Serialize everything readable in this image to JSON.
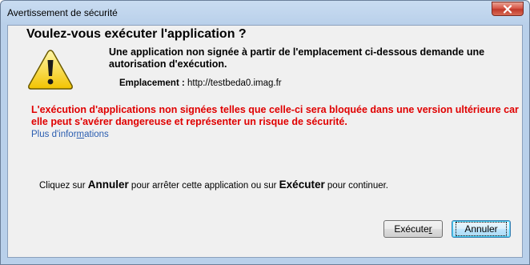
{
  "window": {
    "title": "Avertissement de sécurité"
  },
  "dialog": {
    "heading": "Voulez-vous exécuter l'application ?",
    "description": "Une application non signée à partir de l'emplacement ci-dessous demande une autorisation d'exécution.",
    "location_label": "Emplacement :",
    "location_value": "http://testbeda0.imag.fr",
    "warning": "L'exécution d'applications non signées telles que celle-ci sera bloquée dans une version ultérieure car elle peut s'avérer dangereuse et représenter un risque de sécurité.",
    "more_info_pre": "Plus d'infor",
    "more_info_u": "m",
    "more_info_post": "ations",
    "instruction": {
      "part1": "Cliquez sur ",
      "cancel_word": "Annuler",
      "part2": " pour arrêter cette application ou sur ",
      "run_word": "Exécuter",
      "part3": " pour continuer."
    }
  },
  "buttons": {
    "run_pre": "Exécute",
    "run_u": "r",
    "cancel": "Annuler"
  },
  "icons": {
    "warning": "warning-triangle-icon",
    "close": "close-icon"
  },
  "colors": {
    "warning_text": "#e00000",
    "link": "#2a5db0",
    "close_button": "#c0392b"
  }
}
